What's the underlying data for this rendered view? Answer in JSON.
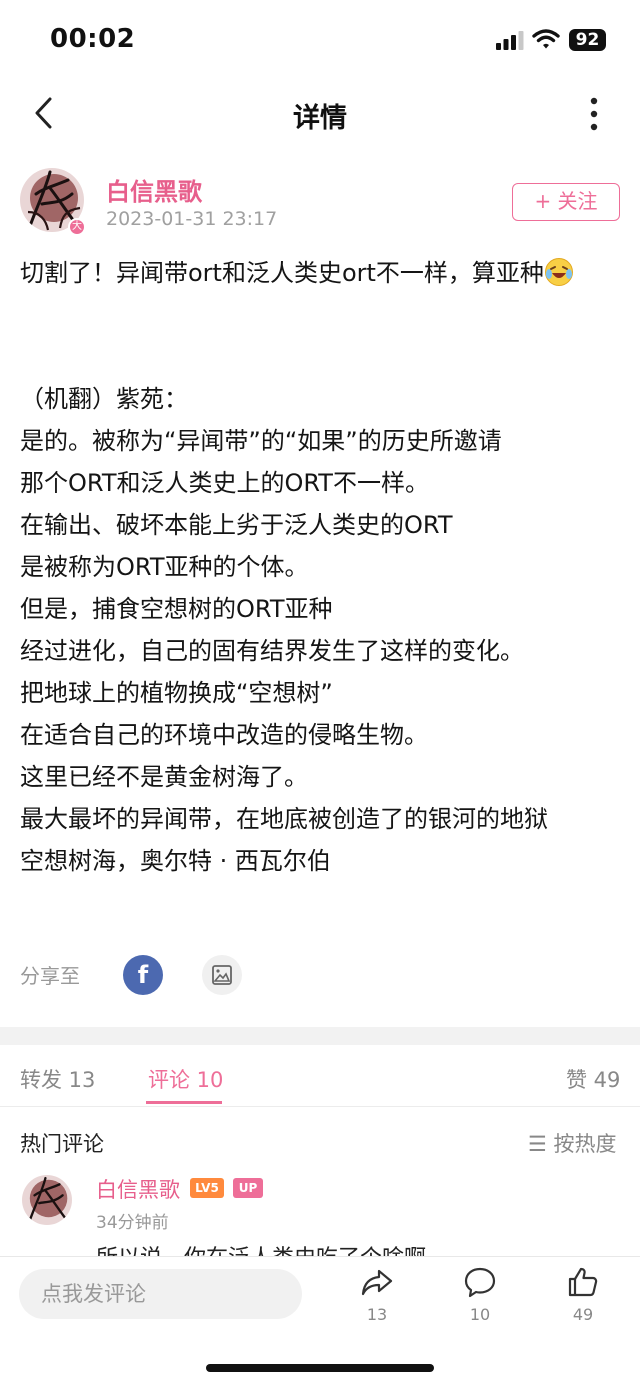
{
  "status_bar": {
    "time": "00:02",
    "battery": "92"
  },
  "nav": {
    "title": "详情",
    "back_icon": "chevron-left-icon",
    "more_icon": "more-vertical-icon"
  },
  "author": {
    "name": "白信黑歌",
    "time": "2023-01-31 23:17",
    "badge": "大",
    "follow_label": "+ 关注"
  },
  "post": {
    "paragraphs": [
      "切割了！异闻带ort和泛人类史ort不一样，算亚种",
      "",
      "",
      "（机翻）紫苑：",
      "是的。被称为“异闻带”的“如果”的历史所邀请",
      "那个ORT和泛人类史上的ORT不一样。",
      "在输出、破坏本能上劣于泛人类史的ORT",
      "是被称为ORT亚种的个体。",
      "但是，捕食空想树的ORT亚种",
      "经过进化，自己的固有结界发生了这样的变化。",
      "把地球上的植物换成“空想树”",
      "在适合自己的环境中改造的侵略生物。",
      "这里已经不是黄金树海了。",
      "最大最坏的异闻带，在地底被创造了的银河的地狱",
      "空想树海，奥尔特 · 西瓦尔伯"
    ]
  },
  "share": {
    "label": "分享至",
    "fb_letter": "f"
  },
  "tabs": {
    "repost": "转发 13",
    "comment": "评论 10",
    "like": "赞 49"
  },
  "comments": {
    "title": "热门评论",
    "sort_label": "☰ 按热度",
    "items": [
      {
        "name": "白信黑歌",
        "level": "LV5",
        "up": "UP",
        "time": "34分钟前",
        "text": "所以说…你在泛人类史吃了个啥啊"
      }
    ]
  },
  "bottom_bar": {
    "placeholder": "点我发评论",
    "repost_count": "13",
    "comment_count": "10",
    "like_count": "49"
  },
  "colors": {
    "accent": "#ee6e98",
    "author_name": "#e75f8c",
    "facebook": "#4c69b0"
  }
}
